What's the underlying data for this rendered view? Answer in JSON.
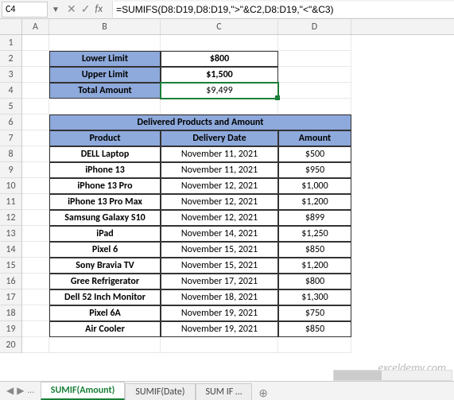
{
  "nameBox": "C4",
  "formula": "=SUMIFS(D8:D19,D8:D19,\">\"&C2,D8:D19,\"<\"&C3)",
  "fx": "fx",
  "cols": {
    "A": "A",
    "B": "B",
    "C": "C",
    "D": "D"
  },
  "rows": [
    "1",
    "2",
    "3",
    "4",
    "5",
    "6",
    "7",
    "8",
    "9",
    "10",
    "11",
    "12",
    "13",
    "14",
    "15",
    "16",
    "17",
    "18",
    "19",
    "20"
  ],
  "limits": {
    "lowerLabel": "Lower Limit",
    "lowerVal": "$800",
    "upperLabel": "Upper Limit",
    "upperVal": "$1,500",
    "totalLabel": "Total Amount",
    "totalVal": "$9,499"
  },
  "table": {
    "title": "Delivered Products and Amount",
    "headers": {
      "product": "Product",
      "date": "Delivery Date",
      "amount": "Amount"
    },
    "rows": [
      {
        "p": "DELL Laptop",
        "d": "November 11, 2021",
        "a": "$500"
      },
      {
        "p": "iPhone 13",
        "d": "November 11, 2021",
        "a": "$950"
      },
      {
        "p": "iPhone 13 Pro",
        "d": "November 12, 2021",
        "a": "$1,000"
      },
      {
        "p": "iPhone 13 Pro Max",
        "d": "November 12, 2021",
        "a": "$1,200"
      },
      {
        "p": "Samsung Galaxy S10",
        "d": "November 12, 2021",
        "a": "$899"
      },
      {
        "p": "iPad",
        "d": "November 14, 2021",
        "a": "$1,250"
      },
      {
        "p": "Pixel 6",
        "d": "November 15, 2021",
        "a": "$850"
      },
      {
        "p": "Sony Bravia TV",
        "d": "November 15, 2021",
        "a": "$1,200"
      },
      {
        "p": "Gree Refrigerator",
        "d": "November 17, 2021",
        "a": "$800"
      },
      {
        "p": "Dell 52 Inch Monitor",
        "d": "November 18, 2021",
        "a": "$1,300"
      },
      {
        "p": "Pixel 6A",
        "d": "November 19, 2021",
        "a": "$750"
      },
      {
        "p": "Air Cooler",
        "d": "November 19, 2021",
        "a": "$850"
      }
    ]
  },
  "tabs": {
    "nav": "…",
    "active": "SUMIF(Amount)",
    "t2": "SUMIF(Date)",
    "t3": "SUM IF …",
    "add": "⊕"
  },
  "watermark": "exceldemy.com"
}
